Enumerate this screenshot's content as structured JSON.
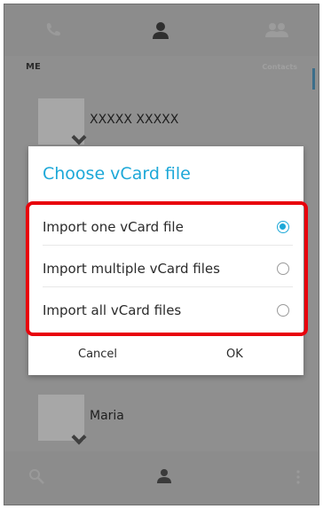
{
  "me_section": {
    "label": "ME",
    "right_label": "Contacts"
  },
  "contacts": [
    {
      "name": "XXXXX XXXXX"
    },
    {
      "name": "Maria"
    }
  ],
  "dialog": {
    "title": "Choose vCard file",
    "options": [
      {
        "label": "Import one vCard file",
        "selected": true
      },
      {
        "label": "Import multiple vCard files",
        "selected": false
      },
      {
        "label": "Import all vCard files",
        "selected": false
      }
    ],
    "cancel_label": "Cancel",
    "ok_label": "OK"
  },
  "colors": {
    "accent": "#1da8d8",
    "highlight": "#e8000b"
  },
  "icons": {
    "tabs": [
      "phone-icon",
      "contacts-tab-icon",
      "groups-icon"
    ],
    "bottom": [
      "search-icon",
      "add-contact-icon",
      "more-options-icon"
    ]
  }
}
